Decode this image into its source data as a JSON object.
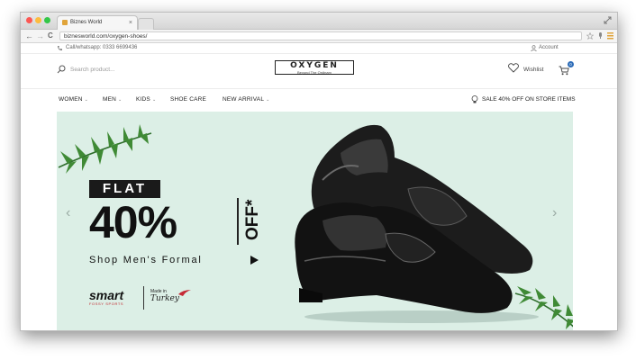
{
  "browser": {
    "tab_title": "Biznes World",
    "tab_close": "×",
    "url": "biznesworld.com/oxygen-shoes/",
    "back": "←",
    "forward": "→",
    "reload": "C"
  },
  "topbar": {
    "contact": "Call/whatsapp: 0333 6699436",
    "account": "Account"
  },
  "header": {
    "search_placeholder": "Search product...",
    "logo_text": "OXYGEN",
    "logo_tagline": "Beyond The Ordinary",
    "wishlist": "Wishlist",
    "cart_count": "0"
  },
  "menu": {
    "items": [
      {
        "label": "WOMEN",
        "has_dropdown": true
      },
      {
        "label": "MEN",
        "has_dropdown": true
      },
      {
        "label": "KIDS",
        "has_dropdown": true
      },
      {
        "label": "SHOE CARE",
        "has_dropdown": false
      },
      {
        "label": "NEW ARRIVAL",
        "has_dropdown": true
      }
    ],
    "sale_text": "SALE 40% OFF ON STORE ITEMS"
  },
  "banner": {
    "flat": "FLAT",
    "percent": "40%",
    "off": "OFF*",
    "cta": "Shop Men's Formal",
    "brand": "smart",
    "brand_sub": "FOSSY SPORTS",
    "made_in": "Made in",
    "country": "Turkey"
  },
  "colors": {
    "banner_bg": "#dcefe6",
    "badge": "#2d6cb8",
    "text_dark": "#111111"
  }
}
